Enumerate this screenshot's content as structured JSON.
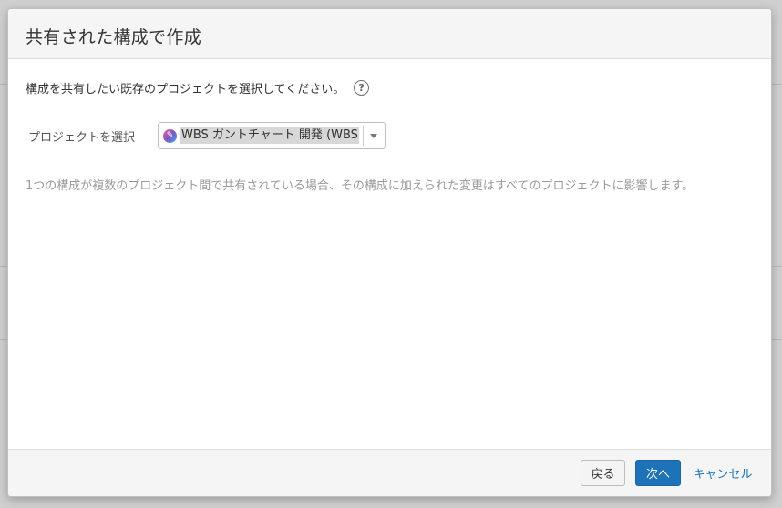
{
  "dialog": {
    "title": "共有された構成で作成",
    "intro": "構成を共有したい既存のプロジェクトを選択してください。",
    "help_icon_glyph": "?",
    "select": {
      "label": "プロジェクトを選択",
      "value": "WBS ガントチャート 開発 (WBS)",
      "avatar_glyph": "✎"
    },
    "note": "1つの構成が複数のプロジェクト間で共有されている場合、その構成に加えられた変更はすべてのプロジェクトに影響します。",
    "footer": {
      "back_label": "戻る",
      "next_label": "次へ",
      "cancel_label": "キャンセル"
    }
  },
  "colors": {
    "primary": "#1d72b8",
    "header_bg": "#f5f5f5",
    "muted_text": "#9a9a9a"
  },
  "icons": {
    "help": "question-circle-icon",
    "avatar": "project-avatar-icon",
    "dropdown": "chevron-down-icon"
  }
}
